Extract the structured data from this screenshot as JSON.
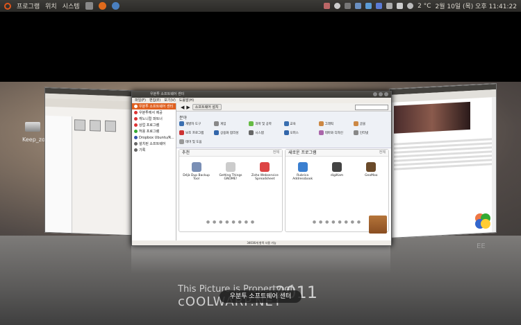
{
  "topbar": {
    "menus": [
      "프로그램",
      "위치",
      "시스템"
    ],
    "temperature": "2 °C",
    "datetime": "2월 10일 (목) 오후 11:41:22"
  },
  "desktop": {
    "icon_label": "Keep_zo"
  },
  "center_window": {
    "title": "우분투 소프트웨어 센터",
    "menus": [
      "파일(F)",
      "편집(E)",
      "보기(V)",
      "도움말(H)"
    ],
    "sidebar": [
      {
        "label": "우분투 소프트웨어 센터",
        "color": "#e0601f",
        "selected": true
      },
      {
        "label": "우분투에서 제공",
        "color": "#d33"
      },
      {
        "label": "캐노니컬 파트너",
        "color": "#d33"
      },
      {
        "label": "상업 프로그램",
        "color": "#d33"
      },
      {
        "label": "허용 프로그램",
        "color": "#3a3"
      },
      {
        "label": "Dropbox Ubuntu/R...",
        "color": "#35a"
      },
      {
        "label": "설치된 소프트웨어",
        "color": "#666"
      },
      {
        "label": "기록",
        "color": "#666"
      }
    ],
    "breadcrumb": "소프트웨어 설치",
    "departments_label": "분야",
    "categories": [
      {
        "label": "개발자 도구",
        "color": "#3a6fb0"
      },
      {
        "label": "게임",
        "color": "#888"
      },
      {
        "label": "과학 및 공학",
        "color": "#6b4"
      },
      {
        "label": "교육",
        "color": "#3a6fb0"
      },
      {
        "label": "그래픽",
        "color": "#c84"
      },
      {
        "label": "글꼴",
        "color": "#c84"
      },
      {
        "label": "보조 프로그램",
        "color": "#c33"
      },
      {
        "label": "상용화 합리성",
        "color": "#36a"
      },
      {
        "label": "시스템",
        "color": "#666"
      },
      {
        "label": "오피스",
        "color": "#36a"
      },
      {
        "label": "테마와 디자인",
        "color": "#a6a"
      },
      {
        "label": "인터넷",
        "color": "#888"
      },
      {
        "label": "테마 및 도움",
        "color": "#999"
      }
    ],
    "featured": {
      "title": "추천",
      "more": "전체",
      "apps": [
        {
          "name": "Déjà Dup Backup Tool",
          "color": "#7a8fb5"
        },
        {
          "name": "Getting Things GNOME!",
          "color": "#ccc"
        },
        {
          "name": "Zoho Webservice Spreadsheet",
          "color": "#d44"
        }
      ]
    },
    "new_apps": {
      "title": "새로운 프로그램",
      "more": "전체",
      "apps": [
        {
          "name": "Rubrica Addressbook",
          "color": "#3a7fd0"
        },
        {
          "name": "digiKam",
          "color": "#444"
        },
        {
          "name": "GnoMoo",
          "color": "#6a4a2a"
        }
      ]
    },
    "status": "34036개 항목 사용 가능"
  },
  "overlay": {
    "watermark_line1": "This Picture is Property of",
    "watermark_line2": "cOOLWARP.NET",
    "watermark_year": "2011",
    "caption": "우분투 소프트웨어 센터",
    "brand": "EE"
  }
}
